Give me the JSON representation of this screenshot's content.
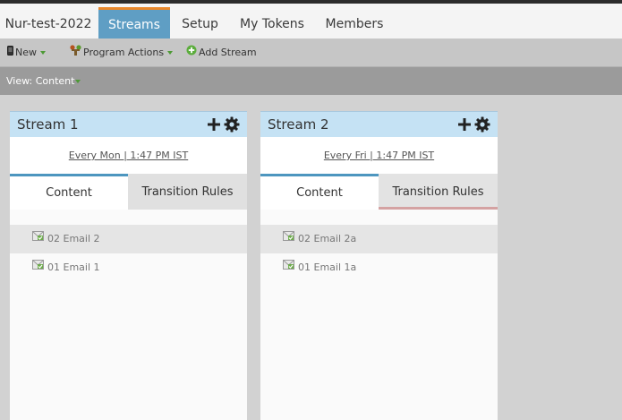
{
  "tabs": [
    {
      "label": "Nur-test-2022",
      "active": false
    },
    {
      "label": "Streams",
      "active": true
    },
    {
      "label": "Setup",
      "active": false
    },
    {
      "label": "My Tokens",
      "active": false
    },
    {
      "label": "Members",
      "active": false
    }
  ],
  "toolbar": {
    "new_label": "New",
    "program_actions_label": "Program Actions",
    "add_stream_label": "Add Stream"
  },
  "view": {
    "label": "View: Content"
  },
  "streams": [
    {
      "title": "Stream 1",
      "schedule": "Every Mon  |  1:47 PM IST",
      "content_tab": "Content",
      "transition_tab": "Transition Rules",
      "items": [
        {
          "label": "02 Email 2",
          "highlighted": true
        },
        {
          "label": "01 Email 1",
          "highlighted": false
        }
      ]
    },
    {
      "title": "Stream 2",
      "schedule": "Every Fri  |  1:47 PM IST",
      "content_tab": "Content",
      "transition_tab": "Transition Rules",
      "items": [
        {
          "label": "02 Email 2a",
          "highlighted": true
        },
        {
          "label": "01 Email 1a",
          "highlighted": false
        }
      ]
    }
  ],
  "colors": {
    "active_tab": "#5f9ec4",
    "active_tab_accent": "#e8872a",
    "stream_header": "#c5e2f4",
    "content_tab_accent": "#4d96bf"
  },
  "icons": {
    "new": "mobile-device-icon",
    "program_actions": "program-actions-icon",
    "add_stream": "add-circle-icon",
    "stream_add": "plus-icon",
    "stream_settings": "gear-icon",
    "email": "email-icon"
  }
}
